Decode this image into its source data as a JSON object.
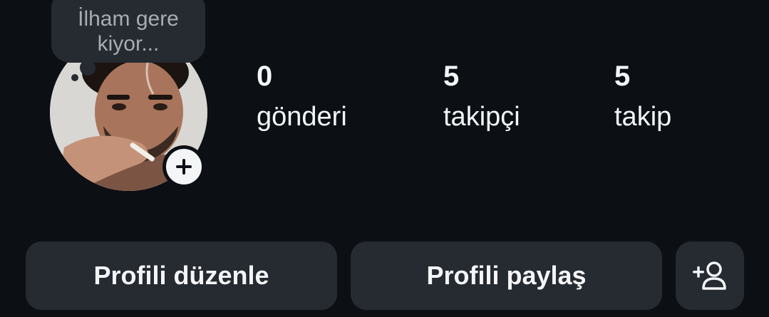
{
  "note": {
    "text": "İlham gere kiyor..."
  },
  "profile": {
    "avatar_icon": "profile-photo",
    "add_story_icon": "plus-icon"
  },
  "stats": {
    "posts": {
      "count": "0",
      "label": "gönderi"
    },
    "followers": {
      "count": "5",
      "label": "takipçi"
    },
    "following": {
      "count": "5",
      "label": "takip"
    }
  },
  "actions": {
    "edit_label": "Profili düzenle",
    "share_label": "Profili paylaş",
    "add_person_icon": "add-person-icon"
  },
  "colors": {
    "background": "#0c0f14",
    "surface": "#262a31",
    "text": "#f3f5f7",
    "note_text": "#a8acb3"
  }
}
